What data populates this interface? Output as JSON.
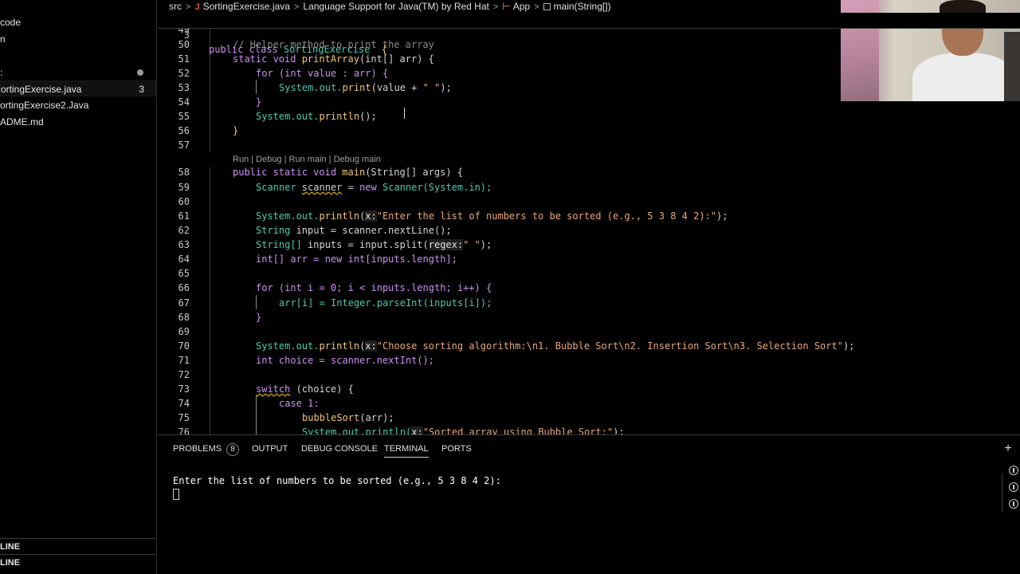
{
  "sidebar": {
    "items": [
      {
        "label": "code"
      },
      {
        "label": "n"
      },
      {
        "label": ":"
      },
      {
        "label": "ortingExercise.java",
        "badge": "3"
      },
      {
        "label": "ortingExercise2.Java"
      },
      {
        "label": "ADME.md"
      }
    ],
    "sections": [
      "LINE",
      "LINE"
    ]
  },
  "breadcrumb": {
    "parts": [
      "src",
      "SortingExercise.java",
      "Language Support for Java(TM) by Red Hat",
      "App",
      "main(String[])"
    ]
  },
  "sticky": {
    "line_number": "3",
    "text": "public class SortingExercise  {"
  },
  "codelens": "Run | Debug | Run main | Debug main",
  "editor_lines": [
    {
      "n": "49"
    },
    {
      "n": "50"
    },
    {
      "n": "51"
    },
    {
      "n": "52"
    },
    {
      "n": "53"
    },
    {
      "n": "54"
    },
    {
      "n": "55"
    },
    {
      "n": "56"
    },
    {
      "n": "57"
    },
    {
      "n": "58"
    },
    {
      "n": "59"
    },
    {
      "n": "60"
    },
    {
      "n": "61"
    },
    {
      "n": "62"
    },
    {
      "n": "63"
    },
    {
      "n": "64"
    },
    {
      "n": "65"
    },
    {
      "n": "66"
    },
    {
      "n": "67"
    },
    {
      "n": "68"
    },
    {
      "n": "69"
    },
    {
      "n": "70"
    },
    {
      "n": "71"
    },
    {
      "n": "72"
    },
    {
      "n": "73"
    },
    {
      "n": "74"
    },
    {
      "n": "75"
    },
    {
      "n": "76"
    }
  ],
  "code": {
    "l50": "// Helper method to print the array",
    "l51_kw": "static void ",
    "l51_fn": "printArray",
    "l51_rest": "(int[] arr) {",
    "l52": "for (int value : arr) {",
    "l53_a": "System.out.",
    "l53_fn": "print",
    "l53_b": "(value + ",
    "l53_str": "\" \"",
    "l53_c": ");",
    "l54": "}",
    "l55_a": "System.out.",
    "l55_fn": "println",
    "l55_b": "();",
    "l56": "}",
    "l58_kw": "public static void ",
    "l58_fn": "main",
    "l58_rest": "(String[] args) {",
    "l59_ty": "Scanner ",
    "l59_var": "scanner",
    "l59_eq": " = ",
    "l59_kw": "new ",
    "l59_rest": "Scanner(System.in);",
    "l61_a": "System.out.",
    "l61_fn": "println",
    "l61_b": "(",
    "l61_hint": "x:",
    "l61_str": "\"Enter the list of numbers to be sorted (e.g., 5 3 8 4 2):\"",
    "l61_c": ");",
    "l62_ty": "String ",
    "l62_rest": "input = scanner.nextLine();",
    "l63_ty": "String[] ",
    "l63_a": "inputs = input.split(",
    "l63_hint": "regex:",
    "l63_str": "\" \"",
    "l63_c": ");",
    "l64": "int[] arr = new int[inputs.length];",
    "l66": "for (int i = 0; i < inputs.length; i++) {",
    "l67": "arr[i] = Integer.parseInt(inputs[i]);",
    "l68": "}",
    "l70_a": "System.out.",
    "l70_fn": "println",
    "l70_b": "(",
    "l70_hint": "x:",
    "l70_str": "\"Choose sorting algorithm:\\n1. Bubble Sort\\n2. Insertion Sort\\n3. Selection Sort\"",
    "l70_c": ");",
    "l71": "int choice = scanner.nextInt();",
    "l73_kw": "switch",
    "l73_rest": " (choice) {",
    "l74": "case 1:",
    "l75_fn": "bubbleSort",
    "l75_rest": "(arr);",
    "l76_a": "System.out.println(",
    "l76_hint": "x:",
    "l76_str": "\"Sorted array using Bubble Sort:\"",
    "l76_c": ");"
  },
  "panel": {
    "tabs": [
      "PROBLEMS",
      "OUTPUT",
      "DEBUG CONSOLE",
      "TERMINAL",
      "PORTS"
    ],
    "problems_count": "8",
    "active_tab": "TERMINAL",
    "terminal_output": "Enter the list of numbers to be sorted (e.g., 5 3 8 4 2):"
  },
  "icons": {
    "add": "plus-icon",
    "debug": "bug-icon"
  }
}
